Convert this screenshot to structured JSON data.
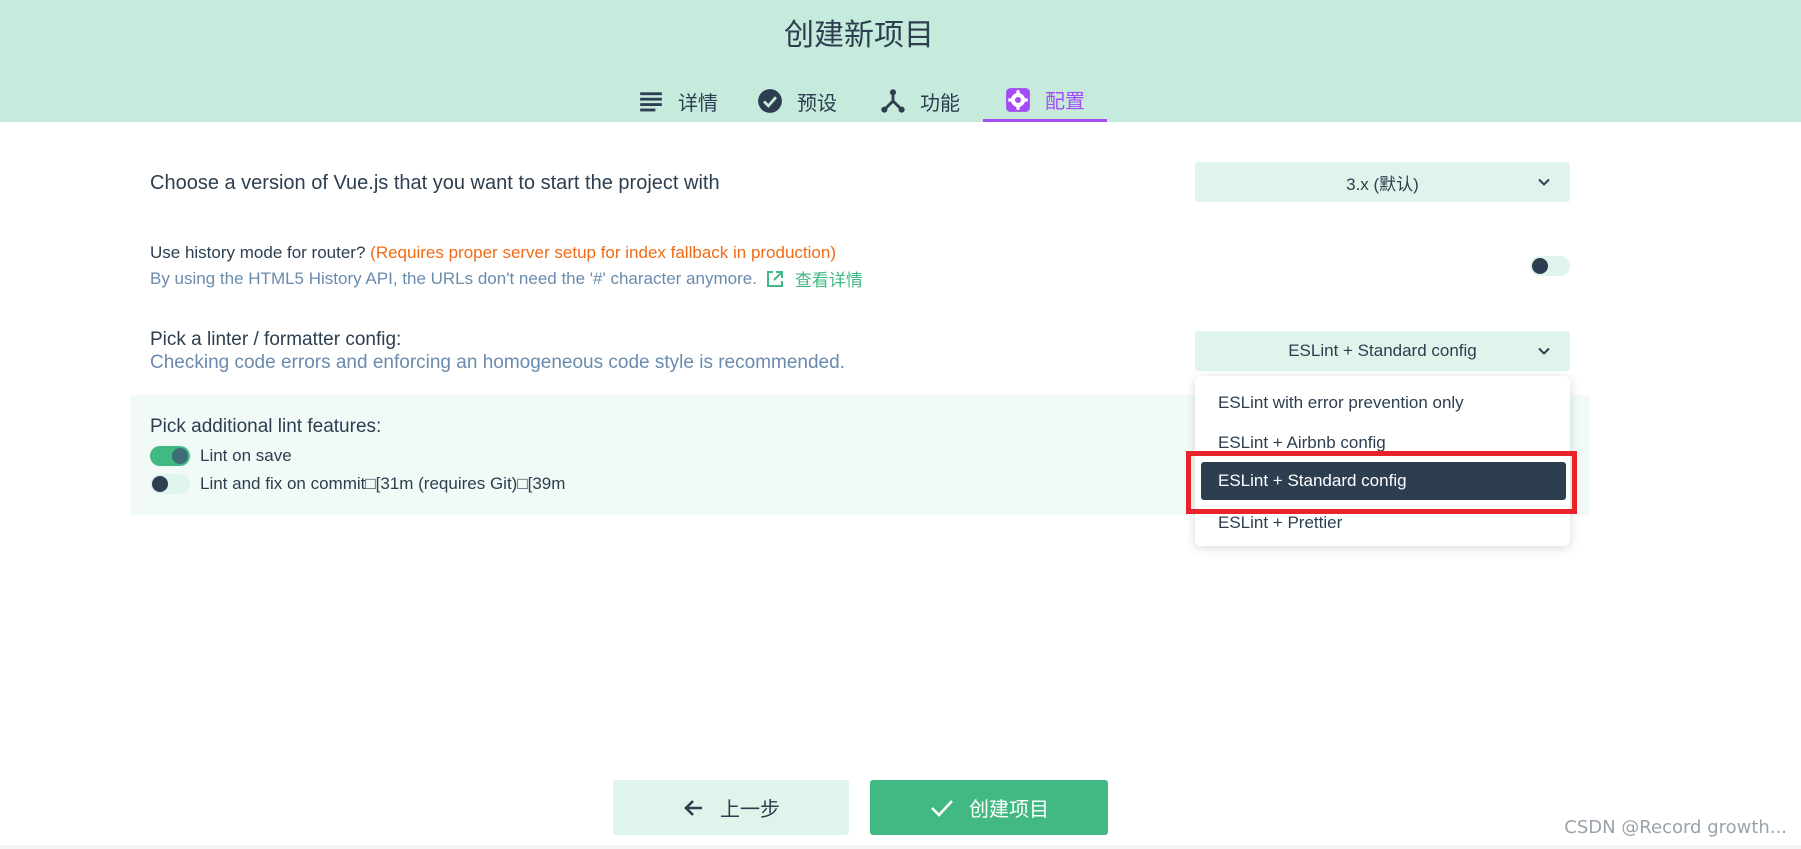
{
  "header": {
    "title": "创建新项目",
    "tabs": [
      {
        "label": "详情",
        "icon": "list-icon"
      },
      {
        "label": "预设",
        "icon": "check-circle-icon"
      },
      {
        "label": "功能",
        "icon": "fork-icon"
      },
      {
        "label": "配置",
        "icon": "gear-icon",
        "active": true
      }
    ]
  },
  "vue_version": {
    "label": "Choose a version of Vue.js that you want to start the project with",
    "selected": "3.x (默认)"
  },
  "history_mode": {
    "label": "Use history mode for router?",
    "warning": "(Requires proper server setup for index fallback in production)",
    "description": "By using the HTML5 History API, the URLs don't need the '#' character anymore.",
    "link": "查看详情",
    "enabled": false
  },
  "linter": {
    "label": "Pick a linter / formatter config:",
    "description": "Checking code errors and enforcing an homogeneous code style is recommended.",
    "selected": "ESLint + Standard config",
    "options": [
      "ESLint with error prevention only",
      "ESLint + Airbnb config",
      "ESLint + Standard config",
      "ESLint + Prettier"
    ]
  },
  "lint_features": {
    "label": "Pick additional lint features:",
    "items": [
      {
        "label": "Lint on save",
        "enabled": true
      },
      {
        "label": "Lint and fix on commit□[31m (requires Git)□[39m",
        "enabled": false
      }
    ]
  },
  "footer": {
    "prev_label": "上一步",
    "create_label": "创建项目"
  },
  "watermark": "CSDN @Record growth...",
  "colors": {
    "accent": "#42b883",
    "active_tab": "#a44cf6",
    "header_bg": "#c6ebdd",
    "highlight": "#e8242a"
  }
}
